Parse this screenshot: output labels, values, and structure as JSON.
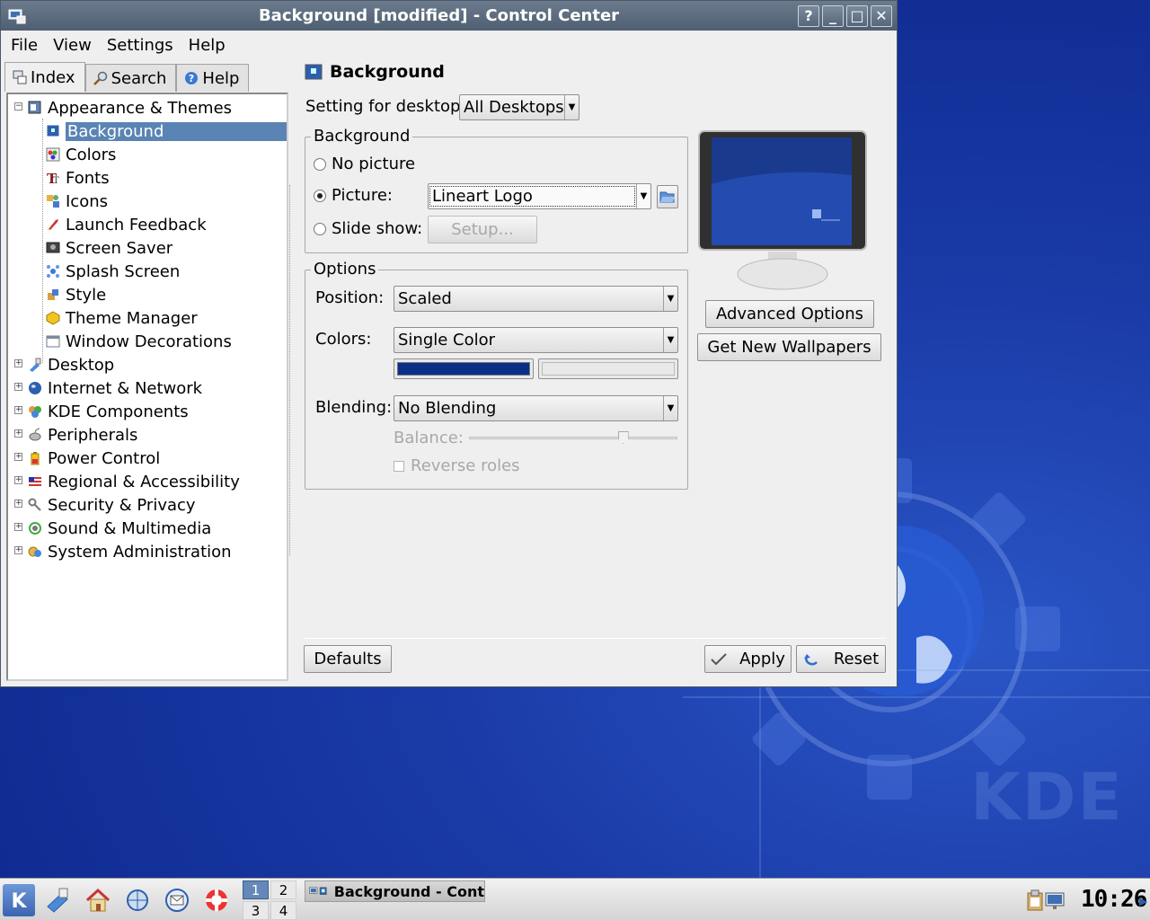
{
  "window": {
    "title": "Background [modified] - Control Center",
    "buttons": {
      "help": "?",
      "minimize": "_",
      "maximize": "□",
      "close": "✕"
    }
  },
  "menubar": {
    "items": [
      "File",
      "View",
      "Settings",
      "Help"
    ]
  },
  "left_tabs": [
    {
      "label": "Index",
      "active": true
    },
    {
      "label": "Search",
      "active": false
    },
    {
      "label": "Help",
      "active": false
    }
  ],
  "tree": {
    "root": "Appearance & Themes",
    "children": [
      {
        "label": "Background",
        "selected": true
      },
      {
        "label": "Colors"
      },
      {
        "label": "Fonts"
      },
      {
        "label": "Icons"
      },
      {
        "label": "Launch Feedback"
      },
      {
        "label": "Screen Saver"
      },
      {
        "label": "Splash Screen"
      },
      {
        "label": "Style"
      },
      {
        "label": "Theme Manager"
      },
      {
        "label": "Window Decorations"
      }
    ],
    "categories": [
      "Desktop",
      "Internet & Network",
      "KDE Components",
      "Peripherals",
      "Power Control",
      "Regional & Accessibility",
      "Security & Privacy",
      "Sound & Multimedia",
      "System Administration"
    ]
  },
  "module": {
    "title": "Background",
    "setting_for_desktop_label": "Setting for desktop:",
    "setting_for_desktop_value": "All Desktops",
    "background_group": {
      "title": "Background",
      "no_picture": "No picture",
      "picture": "Picture:",
      "picture_value": "Lineart Logo",
      "slide_show": "Slide show:",
      "setup": "Setup...",
      "selected": "picture"
    },
    "options_group": {
      "title": "Options",
      "position_label": "Position:",
      "position_value": "Scaled",
      "colors_label": "Colors:",
      "colors_value": "Single Color",
      "color1": "#0a2f86",
      "color2": "#e9e9e9",
      "blending_label": "Blending:",
      "blending_value": "No Blending",
      "balance_label": "Balance:",
      "balance_level": 0.74,
      "reverse_roles": "Reverse roles"
    },
    "advanced_options": "Advanced Options",
    "get_new_wallpapers": "Get New Wallpapers",
    "defaults": "Defaults",
    "apply": "Apply",
    "reset": "Reset"
  },
  "taskbar": {
    "pager": [
      "1",
      "2",
      "3",
      "4"
    ],
    "active_desktop": "1",
    "task_label": "Background - Cont",
    "clock": "10:26"
  },
  "colors": {
    "title_bar": "#5b6b7e",
    "selection": "#5a84b4",
    "desktop_blue": "#1a3aa6"
  }
}
